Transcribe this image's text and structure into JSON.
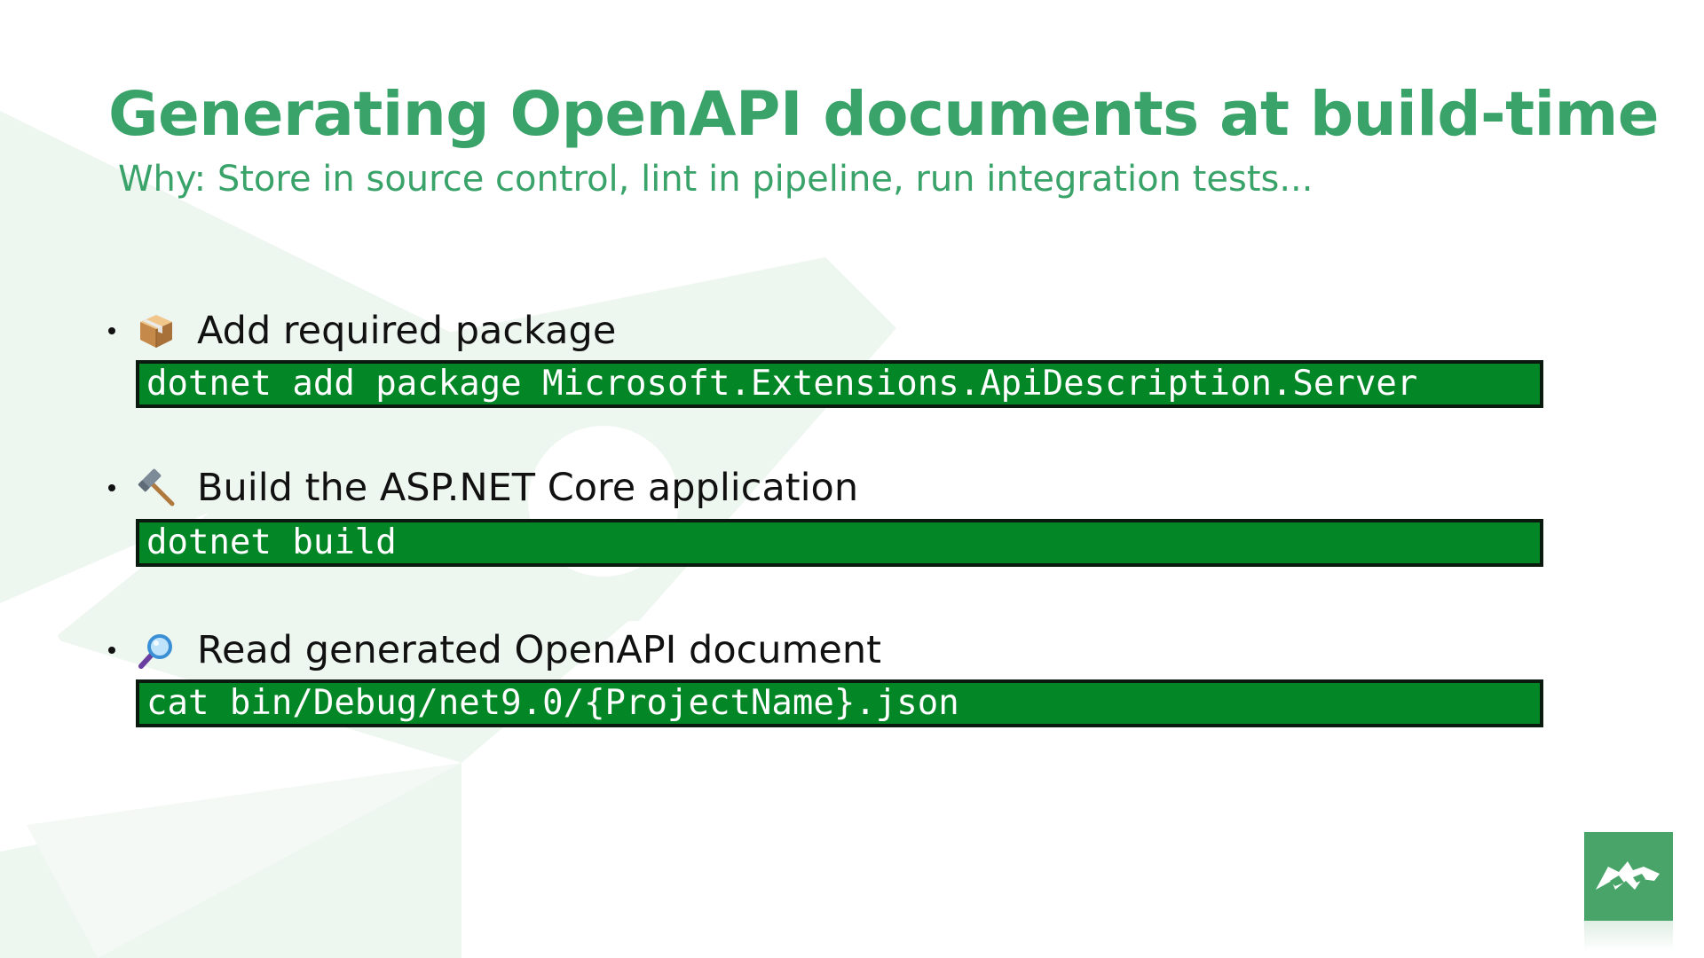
{
  "slide": {
    "title": "Generating OpenAPI documents at build-time",
    "subtitle": "Why: Store in source control, lint in pipeline, run integration tests..."
  },
  "steps": [
    {
      "icon": "package-icon",
      "text": "Add required package",
      "command": "dotnet add package Microsoft.Extensions.ApiDescription.Server"
    },
    {
      "icon": "hammer-icon",
      "text": "Build the ASP.NET Core application",
      "command": "dotnet build"
    },
    {
      "icon": "magnifying-glass-icon",
      "text": "Read generated OpenAPI document",
      "command": "cat bin/Debug/net9.0/{ProjectName}.json"
    }
  ],
  "colors": {
    "accent": "#3aa36a",
    "code_background": "#038626",
    "code_border": "#0b1a0f",
    "logo_background": "#48a468",
    "background_shape": "#eef6f0"
  }
}
